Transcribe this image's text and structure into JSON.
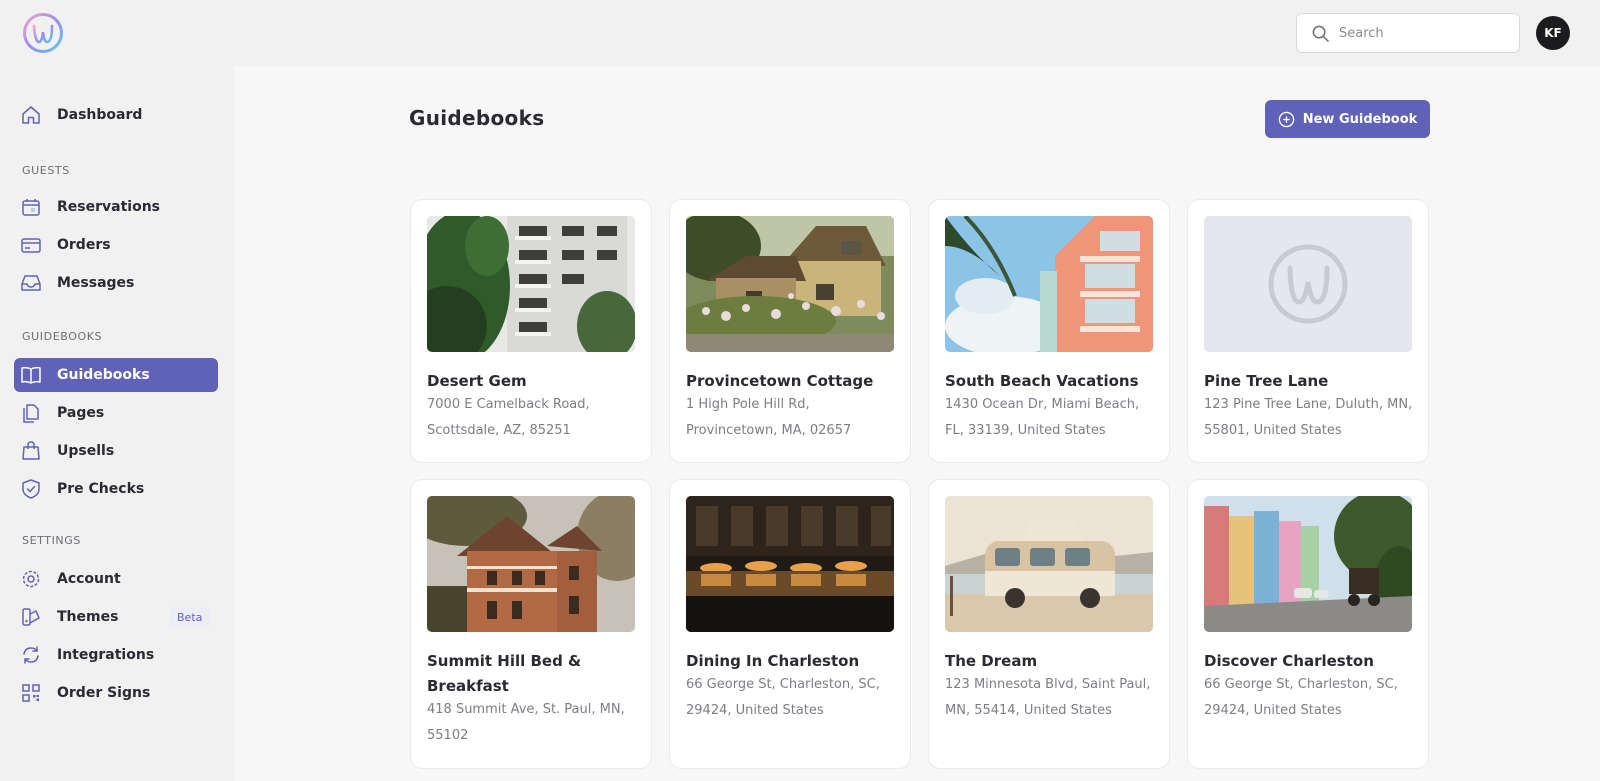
{
  "header": {
    "search_placeholder": "Search",
    "avatar_initials": "KF"
  },
  "sidebar": {
    "sections": {
      "guests": "GUESTS",
      "guidebooks": "GUIDEBOOKS",
      "settings": "SETTINGS"
    },
    "items": [
      {
        "label": "Dashboard",
        "icon": "home-icon"
      },
      {
        "label": "Reservations",
        "icon": "calendar-icon"
      },
      {
        "label": "Orders",
        "icon": "credit-card-icon"
      },
      {
        "label": "Messages",
        "icon": "inbox-icon"
      },
      {
        "label": "Guidebooks",
        "icon": "book-icon",
        "active": true
      },
      {
        "label": "Pages",
        "icon": "pages-icon"
      },
      {
        "label": "Upsells",
        "icon": "shopping-bag-icon"
      },
      {
        "label": "Pre Checks",
        "icon": "shield-check-icon"
      },
      {
        "label": "Account",
        "icon": "gear-icon"
      },
      {
        "label": "Themes",
        "icon": "palette-icon",
        "badge": "Beta"
      },
      {
        "label": "Integrations",
        "icon": "sync-icon"
      },
      {
        "label": "Order Signs",
        "icon": "qr-code-icon"
      }
    ]
  },
  "main": {
    "title": "Guidebooks",
    "new_button": "New Guidebook"
  },
  "guidebooks": [
    {
      "title": "Desert Gem",
      "address": "7000 E Camelback Road, Scottsdale, AZ, 85251",
      "image": "apartment-building-photo"
    },
    {
      "title": "Provincetown Cottage",
      "address": "1 High Pole Hill Rd, Provincetown, MA, 02657",
      "image": "cottage-photo"
    },
    {
      "title": "South Beach Vacations",
      "address": "1430 Ocean Dr, Miami Beach, FL, 33139, United States",
      "image": "art-deco-hotel-photo"
    },
    {
      "title": "Pine Tree Lane",
      "address": "123 Pine Tree Lane, Duluth, MN, 55801, United States",
      "image": "placeholder-logo"
    },
    {
      "title": "Summit Hill Bed & Breakfast",
      "address": "418 Summit Ave, St. Paul, MN, 55102",
      "image": "victorian-house-photo"
    },
    {
      "title": "Dining In Charleston",
      "address": "66 George St, Charleston, SC, 29424, United States",
      "image": "restaurant-night-photo"
    },
    {
      "title": "The Dream",
      "address": "123 Minnesota Blvd, Saint Paul, MN, 55414, United States",
      "image": "camper-van-photo"
    },
    {
      "title": "Discover Charleston",
      "address": "66 George St, Charleston, SC, 29424, United States",
      "image": "colorful-street-photo"
    }
  ],
  "colors": {
    "accent": "#6062b8",
    "background": "#f8f7f7",
    "sidebar": "#f2f1f1"
  }
}
